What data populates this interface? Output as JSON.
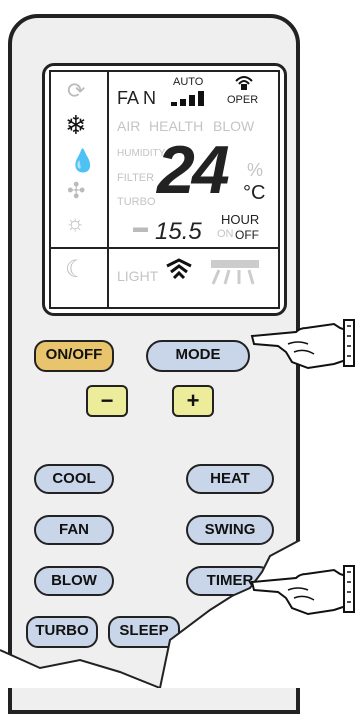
{
  "display": {
    "fan_label": "FA N",
    "auto_label": "AUTO",
    "oper_label": "OPER",
    "air_label": "AIR",
    "health_label": "HEALTH",
    "blow_label": "BLOW",
    "humidity_label": "HUMIDITY",
    "filter_label": "FILTER",
    "turbo_label": "TURBO",
    "temperature": "24",
    "percent": "%",
    "unit": "°C",
    "timer_value": "15.5",
    "hour_label": "HOUR",
    "on_label": "ON",
    "off_label": "OFF",
    "light_label": "LIGHT"
  },
  "buttons": {
    "onoff": "ON/OFF",
    "mode": "MODE",
    "minus": "−",
    "plus": "+",
    "cool": "COOL",
    "heat": "HEAT",
    "fan": "FAN",
    "swing": "SWING",
    "blow": "BLOW",
    "timer": "TIMER",
    "turbo": "TURBO",
    "sleep": "SLEEP"
  }
}
